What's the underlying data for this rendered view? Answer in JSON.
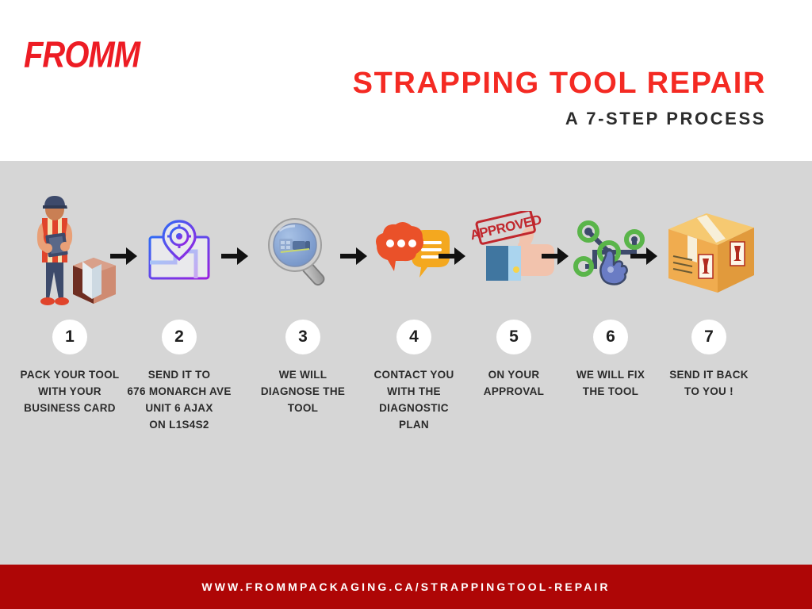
{
  "brand": {
    "logo_text": "FROMM",
    "logo_color": "#ed1c24"
  },
  "header": {
    "title": "STRAPPING TOOL REPAIR",
    "title_color": "#f42a23",
    "subtitle": "A 7-STEP PROCESS",
    "subtitle_color": "#2c2c2c",
    "background": "#ffffff"
  },
  "band": {
    "background": "#d6d6d6"
  },
  "steps": [
    {
      "number": "1",
      "icon": "delivery-person-with-package-icon",
      "label": "PACK YOUR TOOL\nWITH YOUR\nBUSINESS CARD"
    },
    {
      "number": "2",
      "icon": "map-location-pin-icon",
      "label": "SEND IT TO\n676 MONARCH AVE\nUNIT 6 AJAX\nON  L1S4S2"
    },
    {
      "number": "3",
      "icon": "magnifying-glass-icon",
      "label": "WE WILL\nDIAGNOSE THE\nTOOL"
    },
    {
      "number": "4",
      "icon": "chat-bubbles-icon",
      "label": "CONTACT YOU\nWITH THE\nDIAGNOSTIC\nPLAN"
    },
    {
      "number": "5",
      "icon": "thumbs-up-approved-stamp-icon",
      "label": "ON YOUR\nAPPROVAL"
    },
    {
      "number": "6",
      "icon": "repair-nodes-hand-icon",
      "label": "WE WILL FIX\nTHE TOOL"
    },
    {
      "number": "7",
      "icon": "shipping-box-icon",
      "label": "SEND IT BACK\nTO YOU !"
    }
  ],
  "arrow_count": 6,
  "footer": {
    "url": "WWW.FROMMPACKAGING.CA/STRAPPINGTOOL-REPAIR",
    "background": "#ae0606",
    "text_color": "#ffffff"
  }
}
